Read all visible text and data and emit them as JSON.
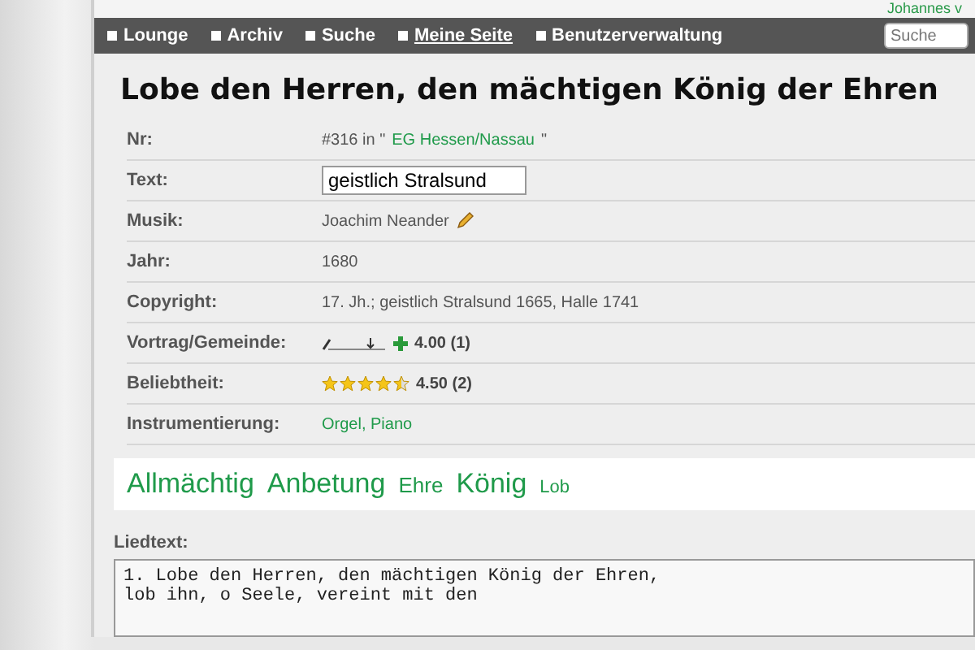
{
  "nav": {
    "items": [
      {
        "label": "Lounge",
        "selected": false
      },
      {
        "label": "Archiv",
        "selected": false
      },
      {
        "label": "Suche",
        "selected": false
      },
      {
        "label": "Meine Seite",
        "selected": true
      },
      {
        "label": "Benutzerverwaltung",
        "selected": false
      }
    ],
    "user": "Johannes v",
    "search": {
      "placeholder": "Suche"
    }
  },
  "title": "Lobe den Herren, den mächtigen König der Ehren",
  "rows": [
    {
      "kind": "ref",
      "label": "Nr:",
      "prefix": "#316 in \"",
      "link": "EG Hessen/Nassau",
      "suffix": "\""
    },
    {
      "kind": "input",
      "label": "Text:",
      "value": "geistlich Stralsund"
    },
    {
      "kind": "editable",
      "label": "Musik:",
      "value": "Joachim Neander"
    },
    {
      "kind": "plain",
      "label": "Jahr:",
      "value": "1680"
    },
    {
      "kind": "plain",
      "label": "Copyright:",
      "value": "17. Jh.; geistlich Stralsund 1665, Halle 1741"
    },
    {
      "kind": "vote",
      "label": "Vortrag/Gemeinde:",
      "value": "4.00 (1)"
    },
    {
      "kind": "stars",
      "label": "Beliebtheit:",
      "stars": 4.5,
      "value": "4.50 (2)"
    },
    {
      "kind": "link",
      "label": "Instrumentierung:",
      "value": "Orgel, Piano"
    }
  ],
  "tags": [
    {
      "label": "Allmächtig",
      "kind": "large"
    },
    {
      "label": "Anbetung",
      "kind": "large"
    },
    {
      "label": "Ehre",
      "kind": "medium"
    },
    {
      "label": "König",
      "kind": "large"
    },
    {
      "label": "Lob",
      "kind": "small"
    }
  ],
  "lyrics": {
    "label": "Liedtext:",
    "lines": [
      "1. Lobe den Herren, den mächtigen König der Ehren,",
      "lob ihn, o Seele, vereint mit den"
    ]
  }
}
